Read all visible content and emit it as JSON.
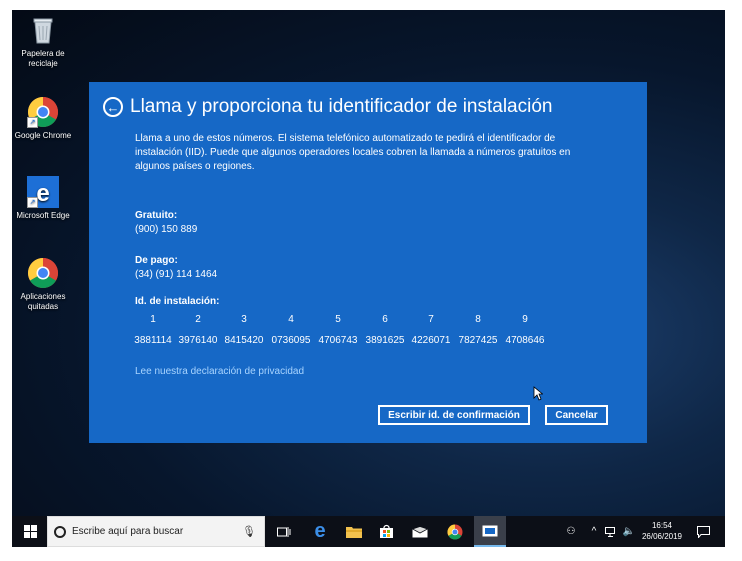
{
  "desktop": {
    "icons": [
      {
        "label": "Papelera de reciclaje"
      },
      {
        "label": "Google Chrome"
      },
      {
        "label": "Microsoft Edge"
      },
      {
        "label": "Aplicaciones quitadas"
      }
    ]
  },
  "dialog": {
    "title": "Llama y proporciona tu identificador de instalación",
    "description": "Llama a uno de estos números. El sistema telefónico automatizado te pedirá el identificador de instalación (IID). Puede que algunos operadores locales cobren la llamada a números gratuitos en algunos países o regiones.",
    "free_label": "Gratuito:",
    "free_number": "(900) 150 889",
    "paid_label": "De pago:",
    "paid_number": "(34) (91) 114 1464",
    "iid_label": "Id. de instalación:",
    "iid_columns": [
      "1",
      "2",
      "3",
      "4",
      "5",
      "6",
      "7",
      "8",
      "9"
    ],
    "iid_values": [
      "3881114",
      "3976140",
      "8415420",
      "0736095",
      "4706743",
      "3891625",
      "4226071",
      "7827425",
      "4708646"
    ],
    "privacy_link": "Lee nuestra declaración de privacidad",
    "confirm_button": "Escribir id. de confirmación",
    "cancel_button": "Cancelar",
    "accent_color": "#1668c6"
  },
  "taskbar": {
    "search_placeholder": "Escribe aquí para buscar",
    "time": "16:54",
    "date": "26/06/2019"
  }
}
